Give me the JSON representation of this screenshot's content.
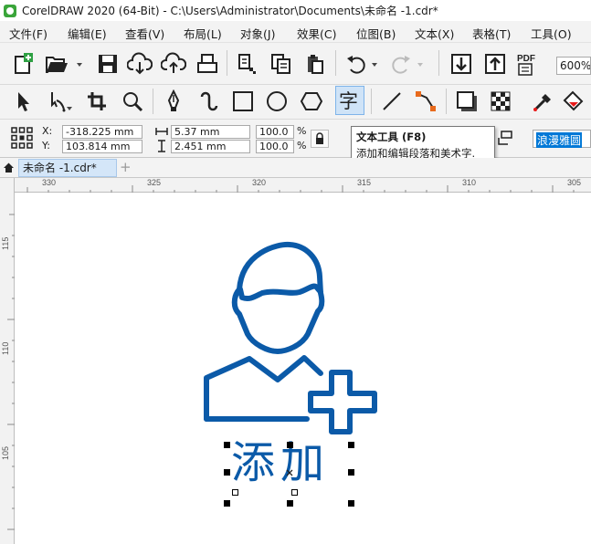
{
  "window": {
    "title": "CorelDRAW 2020 (64-Bit) - C:\\Users\\Administrator\\Documents\\未命名 -1.cdr*"
  },
  "menu": [
    "文件(F)",
    "编辑(E)",
    "查看(V)",
    "布局(L)",
    "对象(J)",
    "效果(C)",
    "位图(B)",
    "文本(X)",
    "表格(T)",
    "工具(O)"
  ],
  "standard_toolbar": {
    "zoom_level": "600%",
    "pdf_label": "PDF"
  },
  "tooltip": {
    "title": "文本工具 (F8)",
    "description": "添加和编辑段落和美术字."
  },
  "property_bar": {
    "x_label": "X:",
    "y_label": "Y:",
    "x_value": "-318.225 mm",
    "y_value": "103.814 mm",
    "width_value": "5.37 mm",
    "height_value": "2.451 mm",
    "scale_x": "100.0",
    "scale_y": "100.0",
    "percent": "%",
    "font_name": "浪漫雅圆"
  },
  "document_tab": {
    "label": "未命名 -1.cdr*",
    "add_label": "+"
  },
  "rulers": {
    "horizontal_ticks": [
      "330",
      "325",
      "320",
      "315",
      "310",
      "305"
    ],
    "vertical_ticks": [
      "115",
      "110",
      "105"
    ]
  },
  "canvas": {
    "text_object": "添加",
    "artwork_color": "#0b5aa8"
  }
}
